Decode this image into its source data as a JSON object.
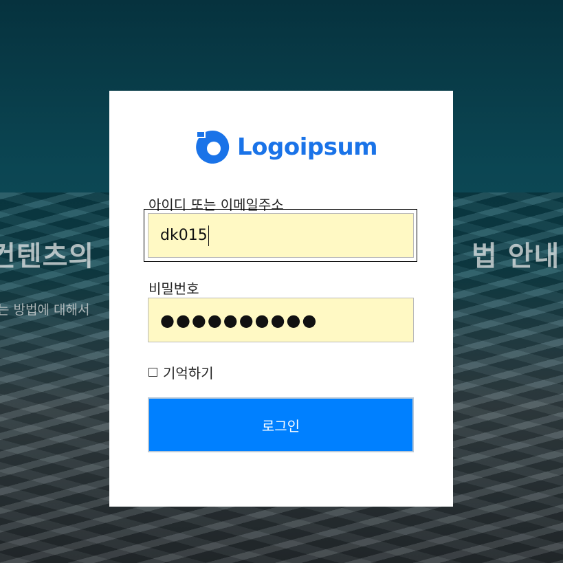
{
  "background": {
    "headline_left": "컨텐츠의",
    "headline_right": "법 안내",
    "subtext": "는 방법에 대해서"
  },
  "logo": {
    "text": "Logoipsum",
    "icon": "logo-mark-icon",
    "color": "#1a73e8"
  },
  "form": {
    "username_label": "아이디 또는 이메일주소",
    "username_value": "dk015",
    "password_label": "비밀번호",
    "password_value": "●●●●●●●●●●",
    "remember_label": "기억하기",
    "remember_checked": false,
    "login_button": "로그인",
    "field_background": "#fff9c4",
    "button_color": "#0080ff"
  }
}
